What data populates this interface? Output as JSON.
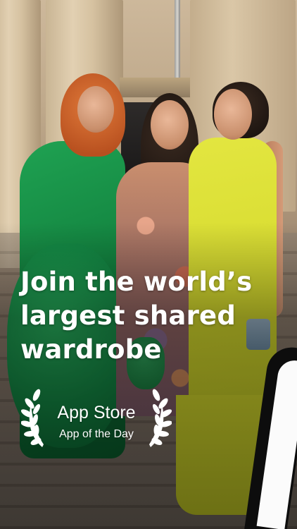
{
  "headline": {
    "line1": "Join the world’s",
    "line2": "largest shared",
    "line3": "wardrobe"
  },
  "award": {
    "title": "App Store",
    "subtitle": "App of the Day"
  },
  "colors": {
    "text": "#ffffff",
    "green_dress": "#128a44",
    "yellow_dress": "#d4d92c"
  },
  "icons": {
    "left_laurel": "laurel-left-icon",
    "right_laurel": "laurel-right-icon"
  }
}
